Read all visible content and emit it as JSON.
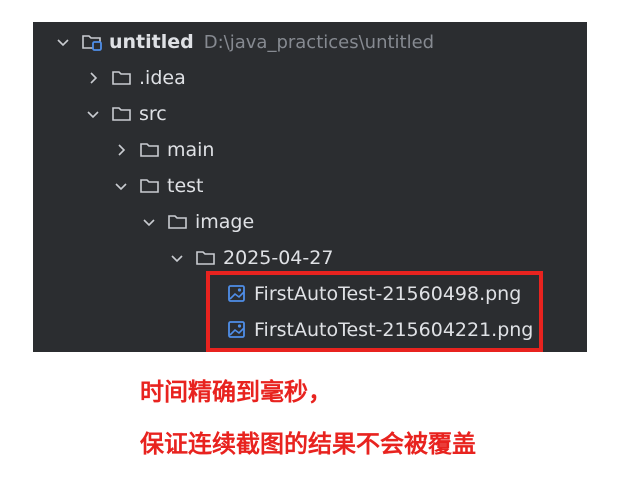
{
  "project_tree": {
    "root": {
      "name": "untitled",
      "path": "D:\\java_practices\\untitled"
    },
    "items": [
      {
        "label": ".idea"
      },
      {
        "label": "src"
      },
      {
        "label": "main"
      },
      {
        "label": "test"
      },
      {
        "label": "image"
      },
      {
        "label": "2025-04-27"
      },
      {
        "label": "FirstAutoTest-21560498.png"
      },
      {
        "label": "FirstAutoTest-215604221.png"
      }
    ]
  },
  "annotation": {
    "line1": "时间精确到毫秒，",
    "line2": "保证连续截图的结果不会被覆盖"
  },
  "colors": {
    "panel_bg": "#2b2d30",
    "text": "#dfe1e5",
    "path_text": "#868a91",
    "accent_red": "#e8231f",
    "image_icon": "#4f8ee8"
  }
}
